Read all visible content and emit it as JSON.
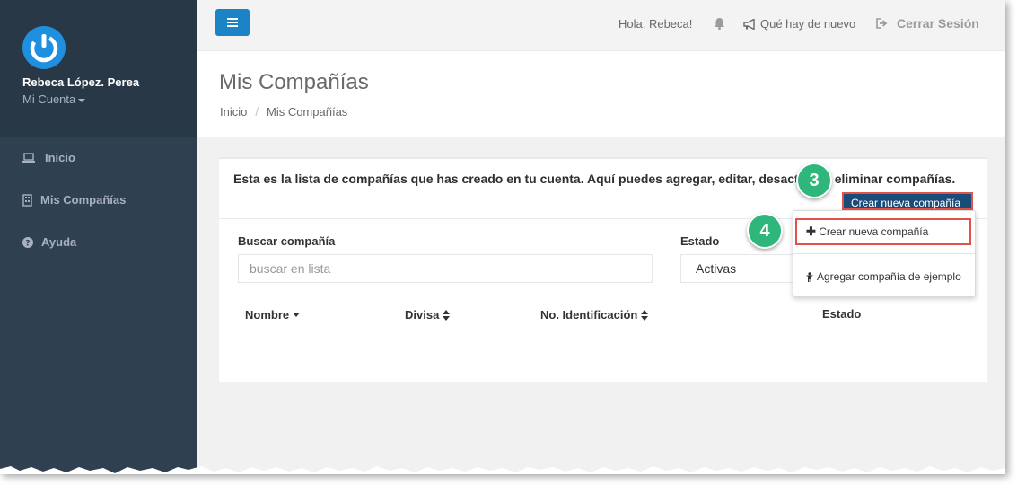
{
  "sidebar": {
    "user_name": "Rebeca López. Perea",
    "account_label": "Mi Cuenta",
    "items": [
      {
        "label": "Inicio",
        "icon": "laptop-icon"
      },
      {
        "label": "Mis Compañías",
        "icon": "building-icon"
      },
      {
        "label": "Ayuda",
        "icon": "question-circle-icon"
      }
    ]
  },
  "topbar": {
    "greeting": "Hola, Rebeca!",
    "news": "Qué hay de nuevo",
    "logout": "Cerrar Sesión"
  },
  "page": {
    "title": "Mis Compañías",
    "breadcrumb": [
      "Inicio",
      "Mis Compañías"
    ]
  },
  "card": {
    "intro_part1": "Esta es la lista de compañías que has creado en tu cuenta. Aquí puedes agregar, editar, desact",
    "intro_part2": "eliminar compañías.",
    "create_button": "Crear nueva compañía",
    "search_label": "Buscar compañía",
    "search_placeholder": "buscar en lista",
    "status_label": "Estado",
    "status_value": "Activas",
    "columns": [
      "Nombre",
      "Divisa",
      "No. Identificación",
      "Estado"
    ]
  },
  "dropdown": {
    "item1": "Crear nueva compañía",
    "item2": "Agregar compañía de ejemplo"
  },
  "steps": [
    "3",
    "4"
  ],
  "colors": {
    "sidebar": "#2f4050",
    "primary": "#1c84c6",
    "create_button": "#1a4c7a",
    "highlight": "#e0524a",
    "step_badge": "#2fb67a"
  }
}
